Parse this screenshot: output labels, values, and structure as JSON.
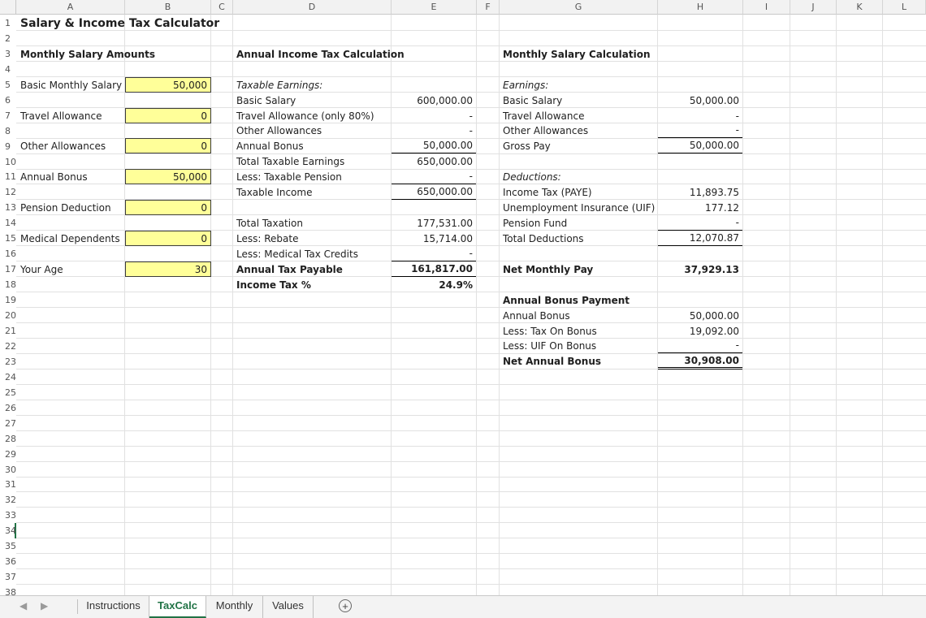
{
  "column_headers": [
    "A",
    "B",
    "C",
    "D",
    "E",
    "F",
    "G",
    "H",
    "I",
    "J",
    "K",
    "L"
  ],
  "row_numbers": [
    "1",
    "2",
    "3",
    "4",
    "5",
    "6",
    "7",
    "8",
    "9",
    "10",
    "11",
    "12",
    "13",
    "14",
    "15",
    "16",
    "17",
    "18",
    "19",
    "20",
    "21",
    "22",
    "23",
    "24",
    "25",
    "26",
    "27",
    "28",
    "29",
    "30",
    "31",
    "32",
    "33",
    "34",
    "35",
    "36",
    "37",
    "38"
  ],
  "title": "Salary & Income Tax Calculator",
  "inputs": {
    "heading": "Monthly Salary Amounts",
    "basic_salary": {
      "label": "Basic Monthly Salary",
      "value": "50,000"
    },
    "travel": {
      "label": "Travel Allowance",
      "value": "0"
    },
    "other": {
      "label": "Other Allowances",
      "value": "0"
    },
    "bonus": {
      "label": "Annual Bonus",
      "value": "50,000"
    },
    "pension": {
      "label": "Pension Deduction",
      "value": "0"
    },
    "medical": {
      "label": "Medical Dependents",
      "value": "0"
    },
    "age": {
      "label": "Your Age",
      "value": "30"
    }
  },
  "annual": {
    "heading": "Annual Income Tax Calculation",
    "taxable_earnings": "Taxable Earnings:",
    "basic_salary": {
      "label": "Basic Salary",
      "value": "600,000.00"
    },
    "travel": {
      "label": "Travel Allowance (only 80%)",
      "value": "-"
    },
    "other": {
      "label": "Other Allowances",
      "value": "-"
    },
    "bonus": {
      "label": "Annual Bonus",
      "value": "50,000.00"
    },
    "total_taxable": {
      "label": "Total Taxable Earnings",
      "value": "650,000.00"
    },
    "less_pension": {
      "label": "Less: Taxable Pension",
      "value": "-"
    },
    "taxable_income": {
      "label": "Taxable Income",
      "value": "650,000.00"
    },
    "total_taxation": {
      "label": "Total Taxation",
      "value": "177,531.00"
    },
    "rebate": {
      "label": "Less: Rebate",
      "value": "15,714.00"
    },
    "medical_credits": {
      "label": "Less: Medical Tax Credits",
      "value": "-"
    },
    "tax_payable": {
      "label": "Annual Tax Payable",
      "value": "161,817.00"
    },
    "tax_pct": {
      "label": "Income Tax %",
      "value": "24.9%"
    }
  },
  "monthly": {
    "heading": "Monthly Salary Calculation",
    "earnings": "Earnings:",
    "basic_salary": {
      "label": "Basic Salary",
      "value": "50,000.00"
    },
    "travel": {
      "label": "Travel Allowance",
      "value": "-"
    },
    "other": {
      "label": "Other Allowances",
      "value": "-"
    },
    "gross": {
      "label": "Gross Pay",
      "value": "50,000.00"
    },
    "deductions": "Deductions:",
    "paye": {
      "label": "Income Tax (PAYE)",
      "value": "11,893.75"
    },
    "uif": {
      "label": "Unemployment Insurance (UIF)",
      "value": "177.12"
    },
    "pension": {
      "label": "Pension Fund",
      "value": "-"
    },
    "total_deductions": {
      "label": "Total Deductions",
      "value": "12,070.87"
    },
    "net": {
      "label": "Net Monthly Pay",
      "value": "37,929.13"
    }
  },
  "bonus_payment": {
    "heading": "Annual Bonus Payment",
    "bonus": {
      "label": "Annual Bonus",
      "value": "50,000.00"
    },
    "tax": {
      "label": "Less: Tax On Bonus",
      "value": "19,092.00"
    },
    "uif": {
      "label": "Less: UIF On Bonus",
      "value": "-"
    },
    "net": {
      "label": "Net Annual Bonus",
      "value": "30,908.00"
    }
  },
  "tabs": [
    "Instructions",
    "TaxCalc",
    "Monthly",
    "Values"
  ],
  "active_tab": "TaxCalc",
  "colors": {
    "input_fill": "#ffff99",
    "accent": "#217346"
  }
}
